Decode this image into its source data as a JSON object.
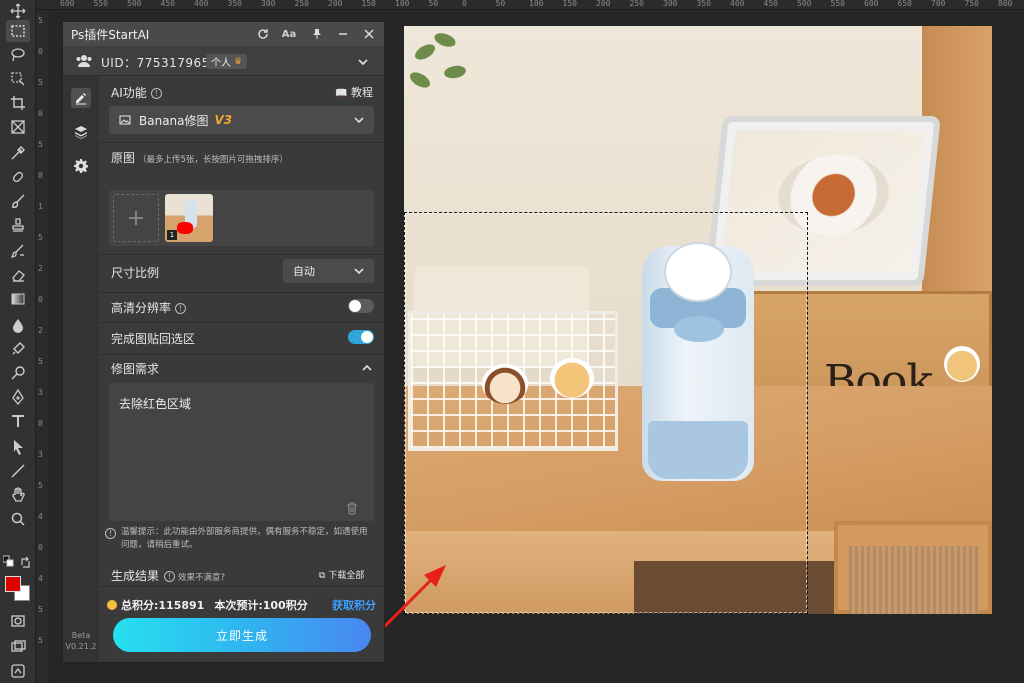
{
  "ruler": {
    "h_labels": [
      "600",
      "550",
      "500",
      "450",
      "400",
      "350",
      "300",
      "250",
      "200",
      "150",
      "100",
      "50",
      "0",
      "50",
      "100",
      "150",
      "200",
      "250",
      "300",
      "350",
      "400",
      "450",
      "500",
      "550",
      "600",
      "650",
      "700",
      "750",
      "800"
    ],
    "v_labels": [
      "5",
      "0",
      "5",
      "0",
      "5",
      "0",
      "1",
      "5",
      "2",
      "0",
      "2",
      "5",
      "3",
      "0",
      "3",
      "5",
      "4",
      "0",
      "4",
      "5",
      "5"
    ]
  },
  "panel": {
    "title": "Ps插件StartAI",
    "uid_text": "UID：775317965",
    "uid_badge": "个人",
    "ai_feature_label": "AI功能",
    "tutorial_label": "教程",
    "model_select": "Banana修图",
    "model_version": "V3",
    "source_label": "原图",
    "source_hint": "（最多上传5张，长按图片可拖拽排序）",
    "thumb_index": "1",
    "ratio_label": "尺寸比例",
    "ratio_value": "自动",
    "hd_label": "高清分辨率",
    "paste_label": "完成图贴回选区",
    "requirement_label": "修图需求",
    "prompt_text": "去除红色区域",
    "notice_text": "温馨提示：此功能由外部服务商提供，偶有服务不稳定，如遇使用问题，请稍后重试。",
    "result_label": "生成结果",
    "result_hint": "效果不满意?",
    "download_all": "下载全部",
    "points_total": "总积分:115891",
    "points_estimate": "本次预计:100积分",
    "get_points": "获取积分",
    "generate_label": "立即生成",
    "version_line1": "Beta",
    "version_line2": "V0.21.2",
    "hd_enabled": false,
    "paste_enabled": true
  },
  "photo": {
    "box_text": "Book"
  },
  "colors": {
    "foreground": "#e00000",
    "background": "#ffffff",
    "accent": "#2ea6d8",
    "link": "#3ea0ff"
  }
}
